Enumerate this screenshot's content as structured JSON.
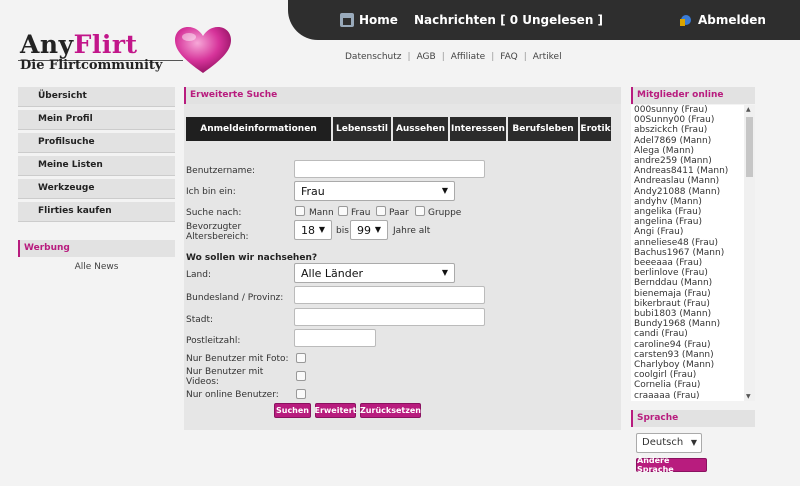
{
  "topbar": {
    "home": "Home",
    "messages": "Nachrichten [ 0 Ungelesen ]",
    "logout": "Abmelden"
  },
  "logo": {
    "part1": "Any",
    "part2": "Flirt",
    "subtitle": "Die Flirtcommunity"
  },
  "sublinks": [
    "Datenschutz",
    "AGB",
    "Affiliate",
    "FAQ",
    "Artikel"
  ],
  "leftmenu": [
    "Übersicht",
    "Mein Profil",
    "Profilsuche",
    "Meine Listen",
    "Werkzeuge",
    "Flirties kaufen"
  ],
  "werbung": {
    "title": "Werbung",
    "news": "Alle News"
  },
  "search": {
    "title": "Erweiterte Suche",
    "tabs": [
      "Anmeldeinformationen",
      "Lebensstil",
      "Aussehen",
      "Interessen",
      "Berufsleben",
      "Erotik"
    ],
    "username_label": "Benutzername:",
    "iam_label": "Ich bin ein:",
    "iam_value": "Frau",
    "search_for_label": "Suche nach:",
    "search_for_options": [
      "Mann",
      "Frau",
      "Paar",
      "Gruppe"
    ],
    "age_label_line1": "Bevorzugter",
    "age_label_line2": "Altersbereich:",
    "age_from": "18",
    "age_to": "99",
    "age_sep": "bis",
    "age_suffix": "Jahre alt",
    "where_title": "Wo sollen wir nachsehen?",
    "country_label": "Land:",
    "country_value": "Alle Länder",
    "state_label": "Bundesland / Provinz:",
    "city_label": "Stadt:",
    "zip_label": "Postleitzahl:",
    "photo_only_label": "Nur Benutzer mit Foto:",
    "video_only_label_line1": "Nur Benutzer mit",
    "video_only_label_line2": "Videos:",
    "online_only_label": "Nur online Benutzer:",
    "btn_search": "Suchen",
    "btn_advanced": "Erweitert",
    "btn_reset": "Zurücksetzen"
  },
  "online": {
    "title": "Mitglieder online",
    "users": [
      "000sunny (Frau)",
      "00Sunny00 (Frau)",
      "abszickch (Frau)",
      "Adel7869 (Mann)",
      "Alega (Mann)",
      "andre259 (Mann)",
      "Andreas8411 (Mann)",
      "Andreaslau (Mann)",
      "Andy21088 (Mann)",
      "andyhv (Mann)",
      "angelika (Frau)",
      "angelina (Frau)",
      "Angi (Frau)",
      "anneliese48 (Frau)",
      "Bachus1967 (Mann)",
      "beeeaaa (Frau)",
      "berlinlove (Frau)",
      "Bernddau (Mann)",
      "bienemaja (Frau)",
      "bikerbraut (Frau)",
      "bubi1803 (Mann)",
      "Bundy1968 (Mann)",
      "candi (Frau)",
      "caroline94 (Frau)",
      "carsten93 (Mann)",
      "Charlyboy (Mann)",
      "coolgirl (Frau)",
      "Cornelia (Frau)",
      "craaaaa (Frau)"
    ]
  },
  "language": {
    "title": "Sprache",
    "value": "Deutsch",
    "button": "Ändere Sprache"
  },
  "colors": {
    "accent": "#b81c7e",
    "topbar": "#2e2e2e"
  }
}
